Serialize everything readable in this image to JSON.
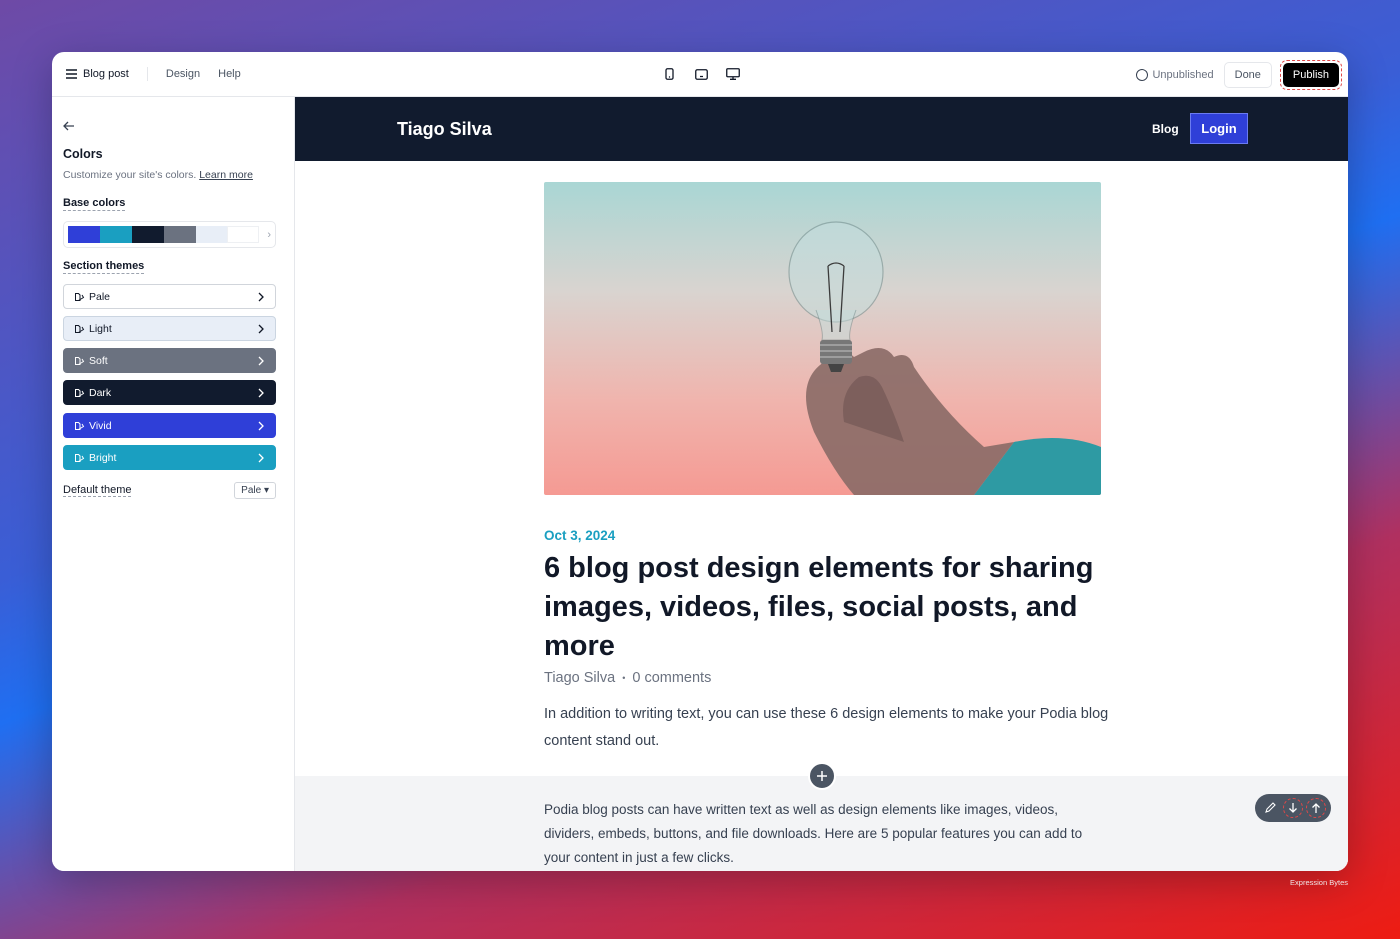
{
  "topbar": {
    "page_label": "Blog post",
    "menu": [
      "Design",
      "Help"
    ],
    "status": "Unpublished",
    "done_label": "Done",
    "publish_label": "Publish"
  },
  "sidebar": {
    "title": "Colors",
    "description": "Customize your site's colors.",
    "learn_more": "Learn more",
    "base_colors_label": "Base colors",
    "base_colors": [
      "#2f3fd8",
      "#1a9fc1",
      "#111b2e",
      "#6b7280",
      "#e8eef7",
      "#ffffff"
    ],
    "section_themes_label": "Section themes",
    "themes": [
      {
        "label": "Pale",
        "bg": "#ffffff",
        "fg": "#111827",
        "border": "#d1d5db"
      },
      {
        "label": "Light",
        "bg": "#e8eef7",
        "fg": "#111827",
        "border": "#cbd5e1"
      },
      {
        "label": "Soft",
        "bg": "#6b7280",
        "fg": "#ffffff",
        "border": "#6b7280"
      },
      {
        "label": "Dark",
        "bg": "#111b2e",
        "fg": "#ffffff",
        "border": "#111b2e"
      },
      {
        "label": "Vivid",
        "bg": "#2f3fd8",
        "fg": "#ffffff",
        "border": "#2f3fd8"
      },
      {
        "label": "Bright",
        "bg": "#1a9fc1",
        "fg": "#ffffff",
        "border": "#1a9fc1"
      }
    ],
    "default_theme_label": "Default theme",
    "default_theme_value": "Pale"
  },
  "site": {
    "name": "Tiago Silva",
    "nav_blog": "Blog",
    "nav_login": "Login"
  },
  "post": {
    "date": "Oct 3, 2024",
    "title": "6 blog post design elements for sharing images, videos, files, social posts, and more",
    "author": "Tiago Silva",
    "separator": "•",
    "comments": "0 comments",
    "intro": "In addition to writing text, you can use these 6 design elements to make your Podia blog content stand out.",
    "body": "Podia blog posts can have written text as well as design elements like images, videos, dividers, embeds, buttons, and file downloads. Here are 5 popular features you can add to your content in just a few clicks."
  },
  "watermark": "Expression Bytes"
}
